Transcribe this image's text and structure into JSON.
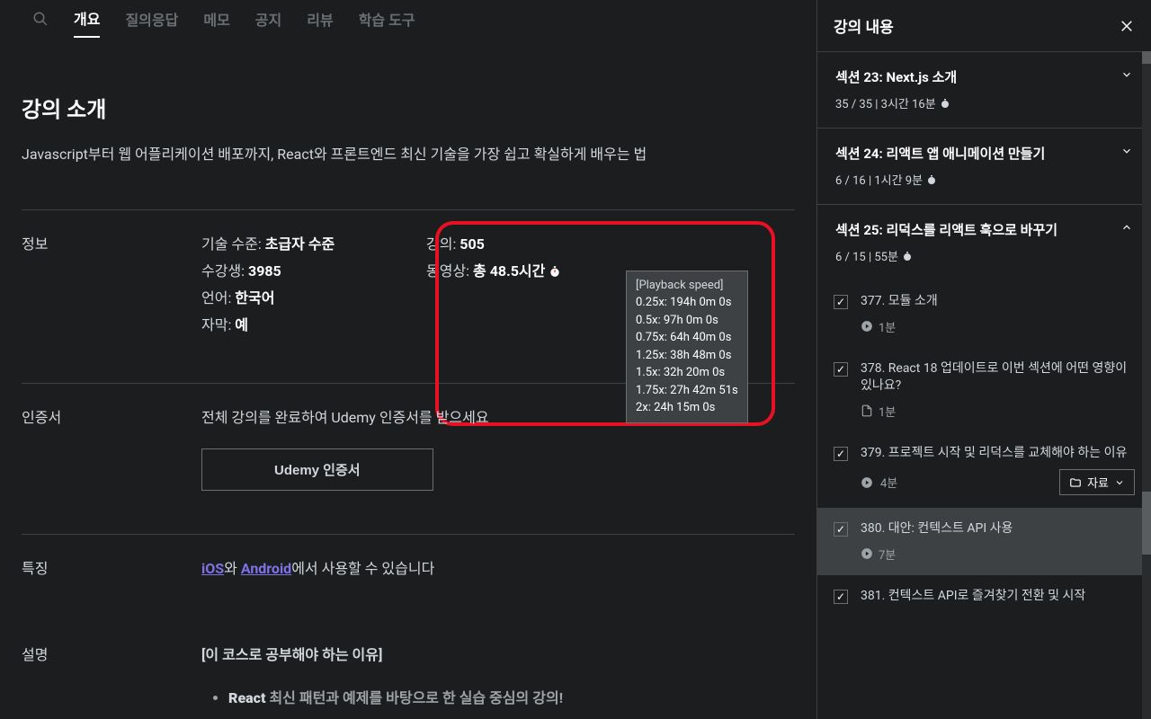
{
  "tabs": [
    "개요",
    "Q&A",
    "메모",
    "공지사항",
    "학습 도구"
  ],
  "activeTabIndex": 0,
  "intro": {
    "title": "강의 소개",
    "desc": "Javascript부터 웹 어플리케이션 배포까지, React와 프론트엔드 최신 기술을 가장 쉽고 확실하게 배우는 법"
  },
  "info": {
    "label": "정보",
    "skill_label": "기술 수준:",
    "skill_value": "초급자 수준",
    "students_label": "수강생:",
    "students_value": "3985",
    "lang_label": "언어:",
    "lang_value": "한국어",
    "captions_label": "자막:",
    "captions_value": "예",
    "lectures_label": "강의:",
    "lectures_value": "505",
    "video_full": "동영상: 총 48.5시간"
  },
  "playback": {
    "title": "[Playback speed]",
    "rows": [
      "0.25x: 194h 0m 0s",
      "0.5x: 97h 0m 0s",
      "0.75x: 64h 40m 0s",
      "1.25x: 38h 48m 0s",
      "1.5x: 32h 20m 0s",
      "1.75x: 27h 42m 51s",
      "2x: 24h 15m 0s"
    ]
  },
  "cert": {
    "label": "인증서",
    "text": "전체 강의를 완료하여 Udemy 인증서를 받으세요",
    "button": "Udemy 인증서"
  },
  "features": {
    "label": "특징",
    "prefix1": "iOS",
    "mid": "와 ",
    "prefix2": "Android",
    "suffix": "에서 사용할 수 있습니다"
  },
  "description": {
    "label": "설명",
    "heading": "[이 코스로 공부해야 하는 이유]",
    "bullets": [
      {
        "bold": "React",
        "rest": " 최신 패턴과 예제를 바탕으로 한 실습 중심의 강의!"
      }
    ]
  },
  "sidebar": {
    "title": "강의 내용",
    "sections": [
      {
        "title": "섹션 23: Next.js 소개",
        "meta": "35 / 35 | 3시간 16분",
        "expanded": false
      },
      {
        "title": "섹션 24: 리액트 앱 애니메이션 만들기",
        "meta": "6 / 16 | 1시간 9분",
        "expanded": false
      },
      {
        "title": "섹션 25: 리덕스를 리액트 훅으로 바꾸기",
        "meta": "6 / 15 | 55분",
        "expanded": true
      }
    ],
    "lectures": [
      {
        "title": "377. 모듈 소개",
        "duration": "1분",
        "type": "video",
        "checked": true
      },
      {
        "title": "378. React 18 업데이트로 이번 섹션에 어떤 영향이 있나요?",
        "duration": "1분",
        "type": "doc",
        "checked": true
      },
      {
        "title": "379. 프로젝트 시작 및 리덕스를 교체해야 하는 이유",
        "duration": "4분",
        "type": "video",
        "checked": true,
        "resources": "자료"
      },
      {
        "title": "380. 대안: 컨텍스트 API 사용",
        "duration": "7분",
        "type": "video",
        "checked": true,
        "active": true
      },
      {
        "title": "381. 컨텍스트 API로 즐겨찾기 전환 및 시작",
        "duration": "",
        "type": "video",
        "checked": true
      }
    ]
  }
}
